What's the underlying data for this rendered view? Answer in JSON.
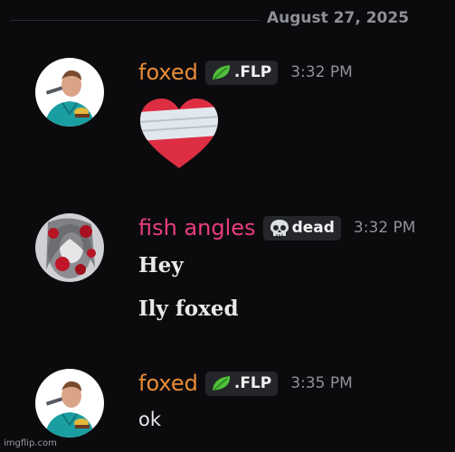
{
  "date_divider": "August 27, 2025",
  "colors": {
    "foxed": "#e98c36",
    "fish_angles": "#e83e7c",
    "background": "#0b0b0d"
  },
  "messages": [
    {
      "author": "foxed",
      "tag_icon": "leaf-icon",
      "tag": ".FLP",
      "time": "3:32 PM",
      "content_type": "emoji",
      "emoji": "mending-heart"
    },
    {
      "author": "fish angles",
      "tag_icon": "skull-icon",
      "tag": "dead",
      "time": "3:32 PM",
      "lines": [
        "Hey",
        "Ily foxed"
      ]
    },
    {
      "author": "foxed",
      "tag_icon": "leaf-icon",
      "tag": ".FLP",
      "time": "3:35 PM",
      "lines": [
        "ok"
      ]
    }
  ],
  "watermark": "imgflip.com"
}
